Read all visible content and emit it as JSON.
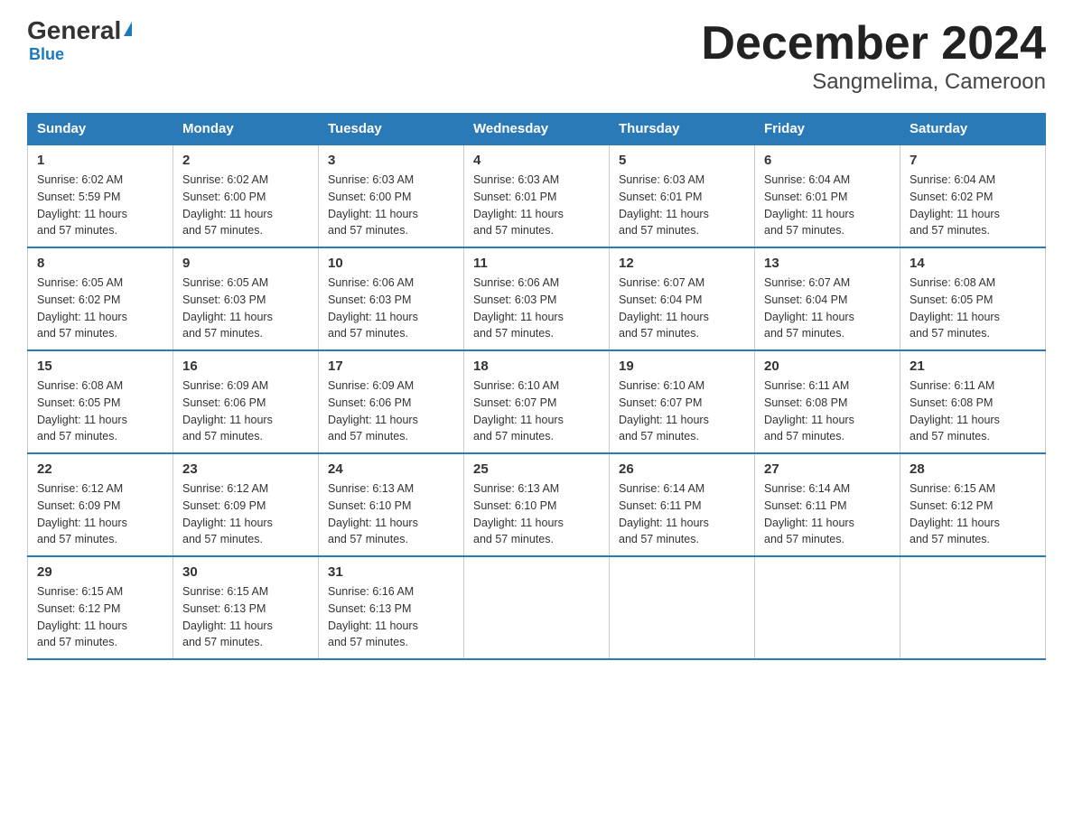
{
  "logo": {
    "text_general": "General",
    "text_blue": "Blue",
    "triangle": "▲"
  },
  "title": "December 2024",
  "subtitle": "Sangmelima, Cameroon",
  "days_of_week": [
    "Sunday",
    "Monday",
    "Tuesday",
    "Wednesday",
    "Thursday",
    "Friday",
    "Saturday"
  ],
  "weeks": [
    [
      {
        "day": "1",
        "sunrise": "6:02 AM",
        "sunset": "5:59 PM",
        "daylight": "11 hours and 57 minutes."
      },
      {
        "day": "2",
        "sunrise": "6:02 AM",
        "sunset": "6:00 PM",
        "daylight": "11 hours and 57 minutes."
      },
      {
        "day": "3",
        "sunrise": "6:03 AM",
        "sunset": "6:00 PM",
        "daylight": "11 hours and 57 minutes."
      },
      {
        "day": "4",
        "sunrise": "6:03 AM",
        "sunset": "6:01 PM",
        "daylight": "11 hours and 57 minutes."
      },
      {
        "day": "5",
        "sunrise": "6:03 AM",
        "sunset": "6:01 PM",
        "daylight": "11 hours and 57 minutes."
      },
      {
        "day": "6",
        "sunrise": "6:04 AM",
        "sunset": "6:01 PM",
        "daylight": "11 hours and 57 minutes."
      },
      {
        "day": "7",
        "sunrise": "6:04 AM",
        "sunset": "6:02 PM",
        "daylight": "11 hours and 57 minutes."
      }
    ],
    [
      {
        "day": "8",
        "sunrise": "6:05 AM",
        "sunset": "6:02 PM",
        "daylight": "11 hours and 57 minutes."
      },
      {
        "day": "9",
        "sunrise": "6:05 AM",
        "sunset": "6:03 PM",
        "daylight": "11 hours and 57 minutes."
      },
      {
        "day": "10",
        "sunrise": "6:06 AM",
        "sunset": "6:03 PM",
        "daylight": "11 hours and 57 minutes."
      },
      {
        "day": "11",
        "sunrise": "6:06 AM",
        "sunset": "6:03 PM",
        "daylight": "11 hours and 57 minutes."
      },
      {
        "day": "12",
        "sunrise": "6:07 AM",
        "sunset": "6:04 PM",
        "daylight": "11 hours and 57 minutes."
      },
      {
        "day": "13",
        "sunrise": "6:07 AM",
        "sunset": "6:04 PM",
        "daylight": "11 hours and 57 minutes."
      },
      {
        "day": "14",
        "sunrise": "6:08 AM",
        "sunset": "6:05 PM",
        "daylight": "11 hours and 57 minutes."
      }
    ],
    [
      {
        "day": "15",
        "sunrise": "6:08 AM",
        "sunset": "6:05 PM",
        "daylight": "11 hours and 57 minutes."
      },
      {
        "day": "16",
        "sunrise": "6:09 AM",
        "sunset": "6:06 PM",
        "daylight": "11 hours and 57 minutes."
      },
      {
        "day": "17",
        "sunrise": "6:09 AM",
        "sunset": "6:06 PM",
        "daylight": "11 hours and 57 minutes."
      },
      {
        "day": "18",
        "sunrise": "6:10 AM",
        "sunset": "6:07 PM",
        "daylight": "11 hours and 57 minutes."
      },
      {
        "day": "19",
        "sunrise": "6:10 AM",
        "sunset": "6:07 PM",
        "daylight": "11 hours and 57 minutes."
      },
      {
        "day": "20",
        "sunrise": "6:11 AM",
        "sunset": "6:08 PM",
        "daylight": "11 hours and 57 minutes."
      },
      {
        "day": "21",
        "sunrise": "6:11 AM",
        "sunset": "6:08 PM",
        "daylight": "11 hours and 57 minutes."
      }
    ],
    [
      {
        "day": "22",
        "sunrise": "6:12 AM",
        "sunset": "6:09 PM",
        "daylight": "11 hours and 57 minutes."
      },
      {
        "day": "23",
        "sunrise": "6:12 AM",
        "sunset": "6:09 PM",
        "daylight": "11 hours and 57 minutes."
      },
      {
        "day": "24",
        "sunrise": "6:13 AM",
        "sunset": "6:10 PM",
        "daylight": "11 hours and 57 minutes."
      },
      {
        "day": "25",
        "sunrise": "6:13 AM",
        "sunset": "6:10 PM",
        "daylight": "11 hours and 57 minutes."
      },
      {
        "day": "26",
        "sunrise": "6:14 AM",
        "sunset": "6:11 PM",
        "daylight": "11 hours and 57 minutes."
      },
      {
        "day": "27",
        "sunrise": "6:14 AM",
        "sunset": "6:11 PM",
        "daylight": "11 hours and 57 minutes."
      },
      {
        "day": "28",
        "sunrise": "6:15 AM",
        "sunset": "6:12 PM",
        "daylight": "11 hours and 57 minutes."
      }
    ],
    [
      {
        "day": "29",
        "sunrise": "6:15 AM",
        "sunset": "6:12 PM",
        "daylight": "11 hours and 57 minutes."
      },
      {
        "day": "30",
        "sunrise": "6:15 AM",
        "sunset": "6:13 PM",
        "daylight": "11 hours and 57 minutes."
      },
      {
        "day": "31",
        "sunrise": "6:16 AM",
        "sunset": "6:13 PM",
        "daylight": "11 hours and 57 minutes."
      },
      null,
      null,
      null,
      null
    ]
  ]
}
